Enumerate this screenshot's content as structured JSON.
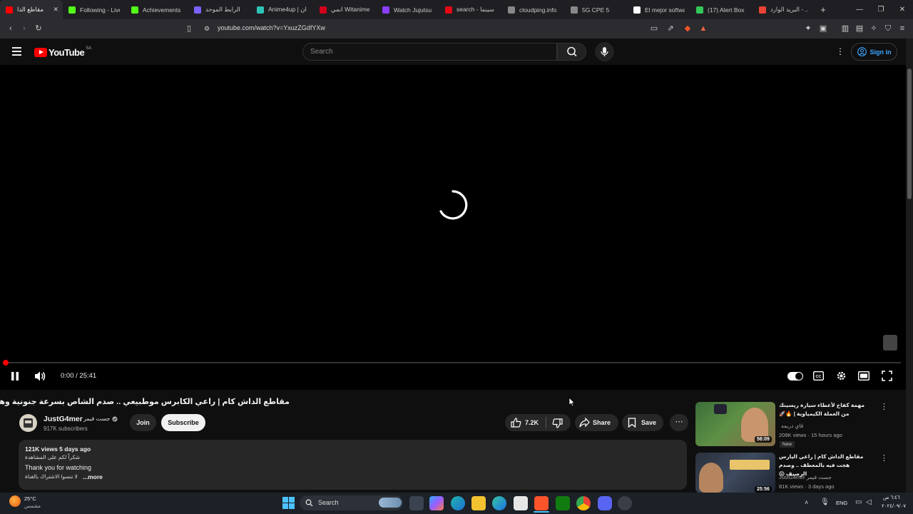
{
  "colors": {
    "accent": "#ff0000",
    "link": "#3ea6ff",
    "background": "#0f0f0f"
  },
  "browser": {
    "tabs": [
      {
        "title": "مقاطع الدا",
        "icon": "youtube-icon",
        "color": "#ff0000",
        "active": true
      },
      {
        "title": "Following - Live",
        "icon": "kick-icon",
        "color": "#53fc18"
      },
      {
        "title": "Achievements",
        "icon": "kick-icon",
        "color": "#53fc18"
      },
      {
        "title": "الرابط الموحد",
        "icon": "c-icon",
        "color": "#7b61ff"
      },
      {
        "title": "Anime4up | ان",
        "icon": "anime-icon",
        "color": "#2ec4b6"
      },
      {
        "title": "انمي Witanime",
        "icon": "bookmark-icon",
        "color": "#d0021b"
      },
      {
        "title": "Watch Jujutsu",
        "icon": "play-icon",
        "color": "#8a3ffc"
      },
      {
        "title": "search - سينما",
        "icon": "cinema-icon",
        "color": "#e50914"
      },
      {
        "title": "cloudping.info",
        "icon": "globe-icon",
        "color": "#888888"
      },
      {
        "title": "5G CPE 5",
        "icon": "globe-icon",
        "color": "#888888"
      },
      {
        "title": "El mejor softwa",
        "icon": "diamond-icon",
        "color": "#ffffff"
      },
      {
        "title": "(17) Alert Box",
        "icon": "alert-icon",
        "color": "#34c759"
      },
      {
        "title": "البريد الوارد - ..",
        "icon": "gmail-icon",
        "color": "#ea4335"
      }
    ],
    "url": "youtube.com/watch?v=YxuzZGdfYXw"
  },
  "youtube": {
    "logo_text": "YouTube",
    "region": "SA",
    "search_placeholder": "Search",
    "sign_in": "Sign in"
  },
  "player": {
    "time": "0:00 / 25:41",
    "progress": 0.0
  },
  "video": {
    "title": "مقاطع الداش كام | راعي الكابرس موطبيعي .. صدم الشاص بسرعة جنونية وهرب 😱",
    "channel": "JustG4mer",
    "channel_alt": "جست قيمر",
    "subscribers": "917K subscribers",
    "join": "Join",
    "subscribe": "Subscribe",
    "likes": "7.2K",
    "share": "Share",
    "save": "Save",
    "description": {
      "meta": "121K views  5 days ago",
      "line1": "شكراً لكم على المشاهدة",
      "line2": "Thank you for watching",
      "line3": "لا تنسوا الاشتراك بالقناة",
      "more": "...more"
    }
  },
  "recommendations": [
    {
      "title": "مهمة كفاح لأعطاء سيارة ريسينك من العملة الكيمياوية | 🔥🚀",
      "channel": "ڤاي دريمه",
      "meta": "208K views · 15 hours ago",
      "badge": "New",
      "duration": "56:09"
    },
    {
      "title": "مقاطع الداش كام | راعي اليارس هجت فيه بالمعطف .. وصدم الرصيف 😱",
      "channel": "JustG4mer جست قيمر",
      "meta": "81K views · 3 days ago",
      "duration": "25:56"
    }
  ],
  "taskbar": {
    "weather_temp": "25°C",
    "weather_desc": "مشمس",
    "search": "Search",
    "lang": "ENG",
    "time": "٦:٤٦ ص",
    "date": "٢٠٢٤/٠٩/٠٧"
  }
}
